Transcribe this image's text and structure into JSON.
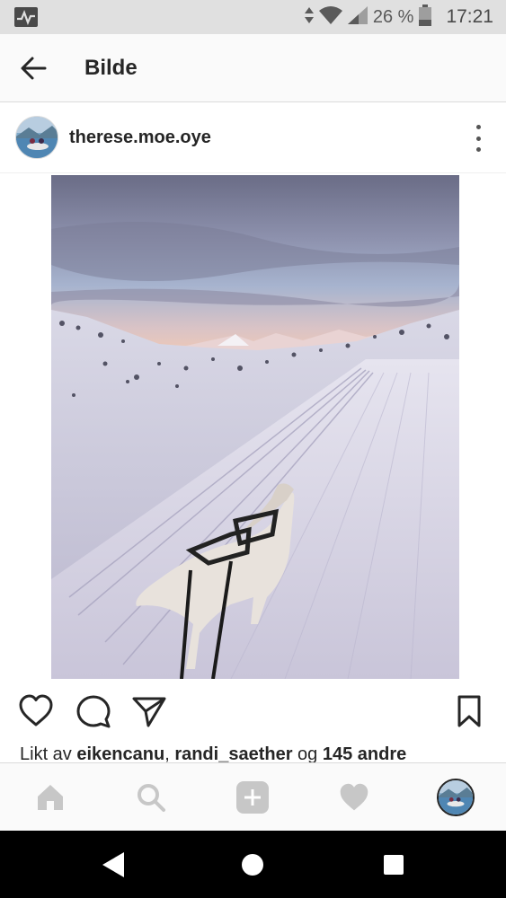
{
  "status_bar": {
    "battery_text": "26 %",
    "clock": "17:21"
  },
  "header": {
    "title": "Bilde"
  },
  "post": {
    "username": "therese.moe.oye",
    "likes": {
      "prefix": "Likt av ",
      "user1": "eikencanu",
      "separator": ", ",
      "user2": "randi_saether",
      "conjunction": " og ",
      "others": "145 andre"
    }
  },
  "icons": {
    "back": "arrow-left-icon",
    "more": "more-vertical-icon",
    "like": "heart-icon",
    "comment": "comment-icon",
    "share": "send-icon",
    "save": "bookmark-icon",
    "home": "home-icon",
    "search": "search-icon",
    "add": "plus-icon",
    "activity": "heart-icon",
    "profile": "avatar"
  },
  "colors": {
    "text": "#262626",
    "nav_inactive": "#c7c7c7",
    "status_bg": "#e0e0e0",
    "header_bg": "#fafafa"
  }
}
